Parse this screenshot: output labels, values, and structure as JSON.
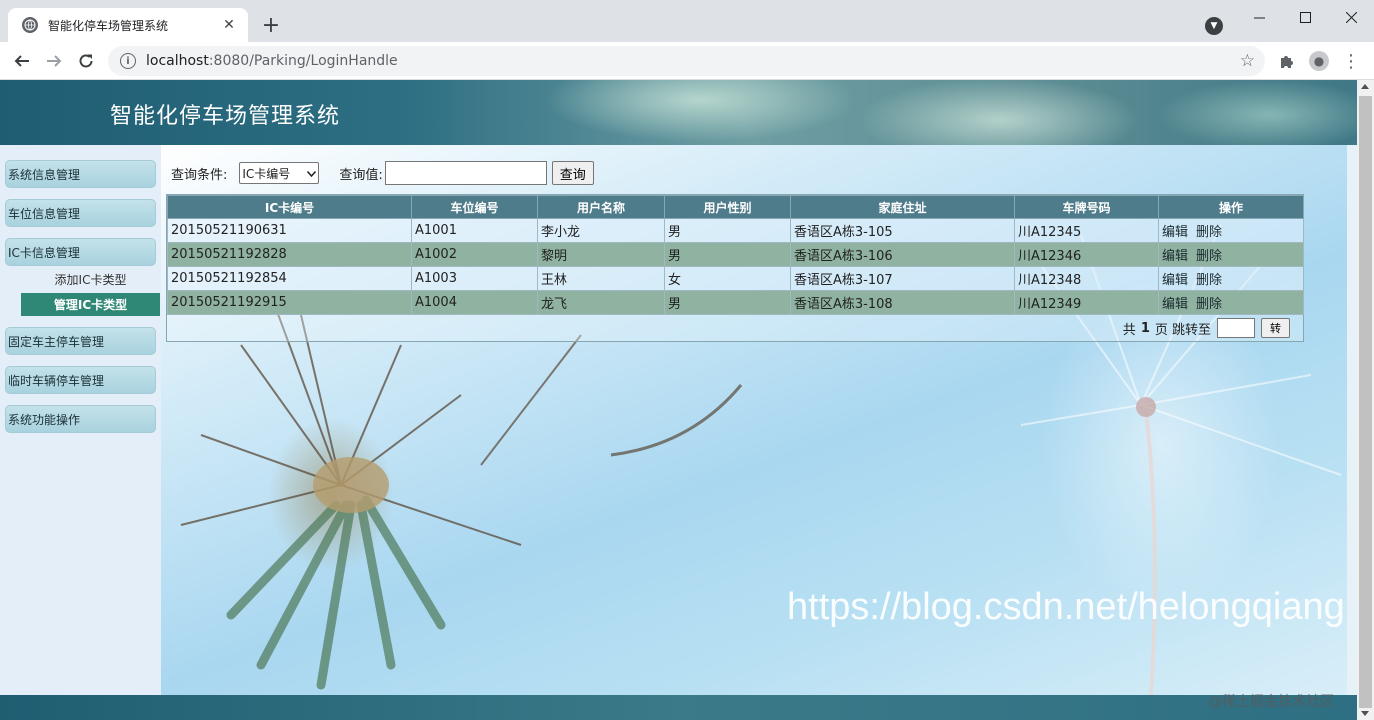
{
  "browser": {
    "tab_title": "智能化停车场管理系统",
    "url_host": "localhost",
    "url_path": ":8080/Parking/LoginHandle"
  },
  "app": {
    "title": "智能化停车场管理系统"
  },
  "sidebar": {
    "items": [
      {
        "label": "系统信息管理"
      },
      {
        "label": "车位信息管理"
      },
      {
        "label": "IC卡信息管理"
      },
      {
        "label": "固定车主停车管理"
      },
      {
        "label": "临时车辆停车管理"
      },
      {
        "label": "系统功能操作"
      }
    ],
    "sub_items": [
      {
        "label": "添加IC卡类型",
        "active": false
      },
      {
        "label": "管理IC卡类型",
        "active": true
      }
    ]
  },
  "search": {
    "condition_label": "查询条件:",
    "condition_selected": "IC卡编号",
    "value_label": "查询值:",
    "value": "",
    "button_label": "查询"
  },
  "table": {
    "columns": [
      "IC卡编号",
      "车位编号",
      "用户名称",
      "用户性别",
      "家庭住址",
      "车牌号码",
      "操作"
    ],
    "rows": [
      {
        "card_no": "20150521190631",
        "slot_no": "A1001",
        "name": "李小龙",
        "gender": "男",
        "address": "香语区A栋3-105",
        "plate": "川A12345"
      },
      {
        "card_no": "20150521192828",
        "slot_no": "A1002",
        "name": "黎明",
        "gender": "男",
        "address": "香语区A栋3-106",
        "plate": "川A12346"
      },
      {
        "card_no": "20150521192854",
        "slot_no": "A1003",
        "name": "王林",
        "gender": "女",
        "address": "香语区A栋3-107",
        "plate": "川A12348"
      },
      {
        "card_no": "20150521192915",
        "slot_no": "A1004",
        "name": "龙飞",
        "gender": "男",
        "address": "香语区A栋3-108",
        "plate": "川A12349"
      }
    ],
    "edit_label": "编辑",
    "delete_label": "删除"
  },
  "pager": {
    "prefix": "共",
    "total_pages": "1",
    "suffix": "页 跳转至",
    "jump_value": "",
    "go_label": "转"
  },
  "watermark": {
    "url": "https://blog.csdn.net/helongqiang",
    "credit": "@稀土掘金技术社区"
  },
  "icons": {
    "favicon": "globe-icon",
    "close": "close-icon",
    "new_tab": "plus-icon",
    "back": "arrow-left-icon",
    "forward": "arrow-right-icon",
    "reload": "reload-icon",
    "info": "info-icon",
    "star": "star-icon",
    "extensions": "puzzle-icon",
    "profile": "profile-icon",
    "menu": "kebab-menu-icon"
  }
}
